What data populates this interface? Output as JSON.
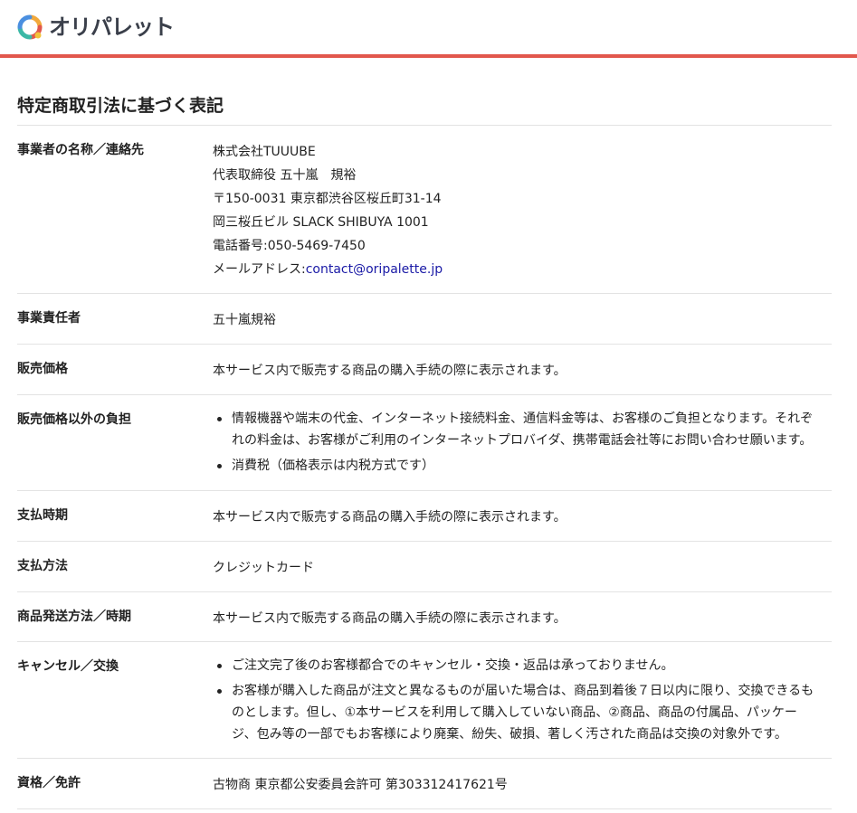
{
  "header": {
    "logo_text": "オリパレット",
    "accent_color": "#e2574c"
  },
  "page": {
    "title": "特定商取引法に基づく表記"
  },
  "rows": [
    {
      "label": "事業者の名称／連絡先",
      "lines": [
        "株式会社TUUUBE",
        "代表取締役 五十嵐　規裕",
        "〒150-0031 東京都渋谷区桜丘町31-14",
        "岡三桜丘ビル SLACK SHIBUYA 1001",
        "電話番号:050-5469-7450"
      ],
      "email_prefix": "メールアドレス:",
      "email": "contact@oripalette.jp"
    },
    {
      "label": "事業責任者",
      "value": "五十嵐規裕"
    },
    {
      "label": "販売価格",
      "value": "本サービス内で販売する商品の購入手続の際に表示されます。"
    },
    {
      "label": "販売価格以外の負担",
      "items": [
        [
          "情報機器や端末の代金、インターネット接続料金、通信料金等は、お客様のご負担となります。それぞ",
          "れの料金は、お客様がご利用のインターネットプロバイダ、携帯電話会社等にお問い合わせ願います。"
        ],
        [
          "消費税（価格表示は内税方式です）"
        ]
      ]
    },
    {
      "label": "支払時期",
      "value": "本サービス内で販売する商品の購入手続の際に表示されます。"
    },
    {
      "label": "支払方法",
      "value": "クレジットカード"
    },
    {
      "label": "商品発送方法／時期",
      "value": "本サービス内で販売する商品の購入手続の際に表示されます。"
    },
    {
      "label": "キャンセル／交換",
      "items": [
        [
          "ご注文完了後のお客様都合でのキャンセル・交換・返品は承っておりません。"
        ],
        [
          "お客様が購入した商品が注文と異なるものが届いた場合は、商品到着後７日以内に限り、交換できるも",
          "のとします。但し、①本サービスを利用して購入していない商品、②商品、商品の付属品、パッケー",
          "ジ、包み等の一部でもお客様により廃棄、紛失、破損、著しく汚された商品は交換の対象外です。"
        ]
      ]
    },
    {
      "label": "資格／免許",
      "value": "古物商 東京都公安委員会許可 第303312417621号"
    }
  ]
}
